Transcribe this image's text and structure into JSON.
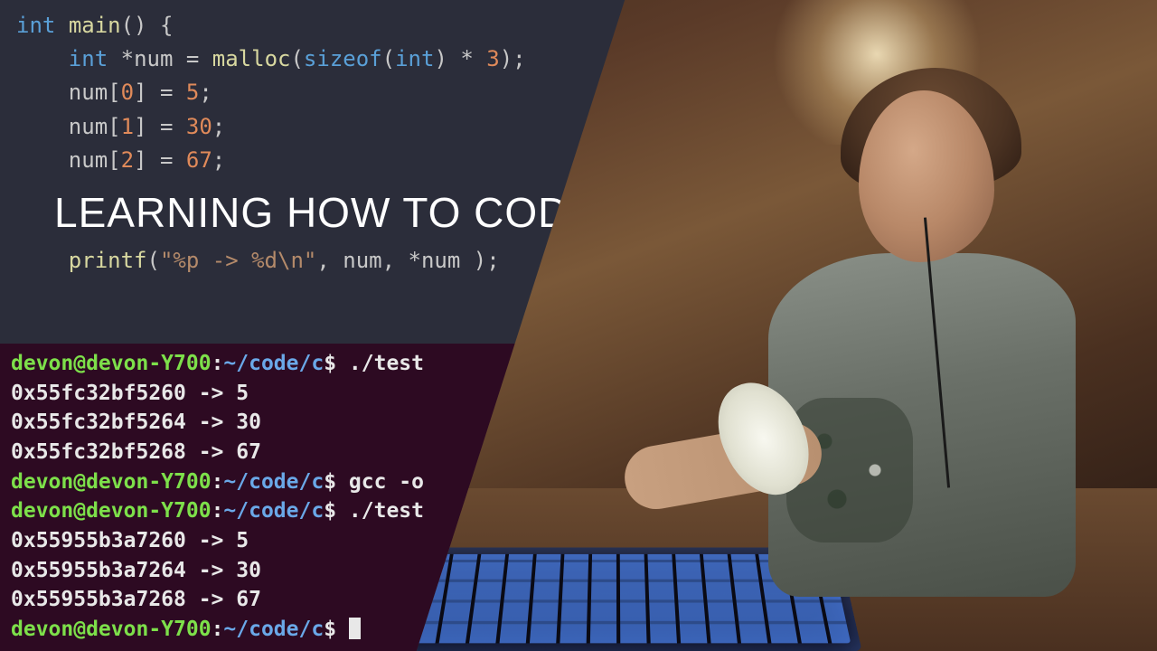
{
  "title": "LEARNING HOW TO CODE",
  "editor": {
    "lines": [
      {
        "tokens": [
          {
            "t": "kw-type",
            "v": "int"
          },
          {
            "t": "punct",
            "v": " "
          },
          {
            "t": "fn-name",
            "v": "main"
          },
          {
            "t": "punct",
            "v": "() {"
          }
        ]
      },
      {
        "tokens": [
          {
            "t": "punct",
            "v": "    "
          },
          {
            "t": "kw-type",
            "v": "int"
          },
          {
            "t": "punct",
            "v": " "
          },
          {
            "t": "op",
            "v": "*"
          },
          {
            "t": "ident",
            "v": "num "
          },
          {
            "t": "op",
            "v": "= "
          },
          {
            "t": "fn-name",
            "v": "malloc"
          },
          {
            "t": "punct",
            "v": "("
          },
          {
            "t": "kw-func",
            "v": "sizeof"
          },
          {
            "t": "punct",
            "v": "("
          },
          {
            "t": "kw-type",
            "v": "int"
          },
          {
            "t": "punct",
            "v": ") "
          },
          {
            "t": "op",
            "v": "* "
          },
          {
            "t": "num-lit",
            "v": "3"
          },
          {
            "t": "punct",
            "v": ");"
          }
        ]
      },
      {
        "tokens": [
          {
            "t": "punct",
            "v": "    "
          },
          {
            "t": "ident",
            "v": "num"
          },
          {
            "t": "punct",
            "v": "["
          },
          {
            "t": "idx",
            "v": "0"
          },
          {
            "t": "punct",
            "v": "] "
          },
          {
            "t": "op",
            "v": "= "
          },
          {
            "t": "num-lit",
            "v": "5"
          },
          {
            "t": "punct",
            "v": ";"
          }
        ]
      },
      {
        "tokens": [
          {
            "t": "punct",
            "v": "    "
          },
          {
            "t": "ident",
            "v": "num"
          },
          {
            "t": "punct",
            "v": "["
          },
          {
            "t": "idx",
            "v": "1"
          },
          {
            "t": "punct",
            "v": "] "
          },
          {
            "t": "op",
            "v": "= "
          },
          {
            "t": "num-lit",
            "v": "30"
          },
          {
            "t": "punct",
            "v": ";"
          }
        ]
      },
      {
        "tokens": [
          {
            "t": "punct",
            "v": "    "
          },
          {
            "t": "ident",
            "v": "num"
          },
          {
            "t": "punct",
            "v": "["
          },
          {
            "t": "idx",
            "v": "2"
          },
          {
            "t": "punct",
            "v": "] "
          },
          {
            "t": "op",
            "v": "= "
          },
          {
            "t": "num-lit",
            "v": "67"
          },
          {
            "t": "punct",
            "v": ";"
          }
        ]
      },
      {
        "tokens": [
          {
            "t": "punct",
            "v": " "
          }
        ]
      },
      {
        "tokens": [
          {
            "t": "punct",
            "v": " "
          }
        ]
      },
      {
        "tokens": [
          {
            "t": "punct",
            "v": "    "
          },
          {
            "t": "fn-name",
            "v": "printf"
          },
          {
            "t": "punct",
            "v": "("
          },
          {
            "t": "str-lit",
            "v": "\"%p -> %d\\n\""
          },
          {
            "t": "punct",
            "v": ", "
          },
          {
            "t": "ident",
            "v": "num"
          },
          {
            "t": "punct",
            "v": ", "
          },
          {
            "t": "op",
            "v": "*"
          },
          {
            "t": "ident",
            "v": "num "
          },
          {
            "t": "punct",
            "v": ");"
          }
        ]
      }
    ]
  },
  "terminal": {
    "prompt_user": "devon@devon-Y700",
    "prompt_sep1": ":",
    "prompt_path": "~/code/c",
    "prompt_end": "$",
    "lines": [
      {
        "type": "prompt",
        "cmd": "./test"
      },
      {
        "type": "out",
        "text": "0x55fc32bf5260 -> 5"
      },
      {
        "type": "out",
        "text": "0x55fc32bf5264 -> 30"
      },
      {
        "type": "out",
        "text": "0x55fc32bf5268 -> 67"
      },
      {
        "type": "prompt",
        "cmd": "gcc -o"
      },
      {
        "type": "prompt",
        "cmd": "./test"
      },
      {
        "type": "out",
        "text": "0x55955b3a7260 -> 5"
      },
      {
        "type": "out",
        "text": "0x55955b3a7264 -> 30"
      },
      {
        "type": "out",
        "text": "0x55955b3a7268 -> 67"
      },
      {
        "type": "prompt",
        "cmd": "",
        "cursor": true
      }
    ]
  }
}
